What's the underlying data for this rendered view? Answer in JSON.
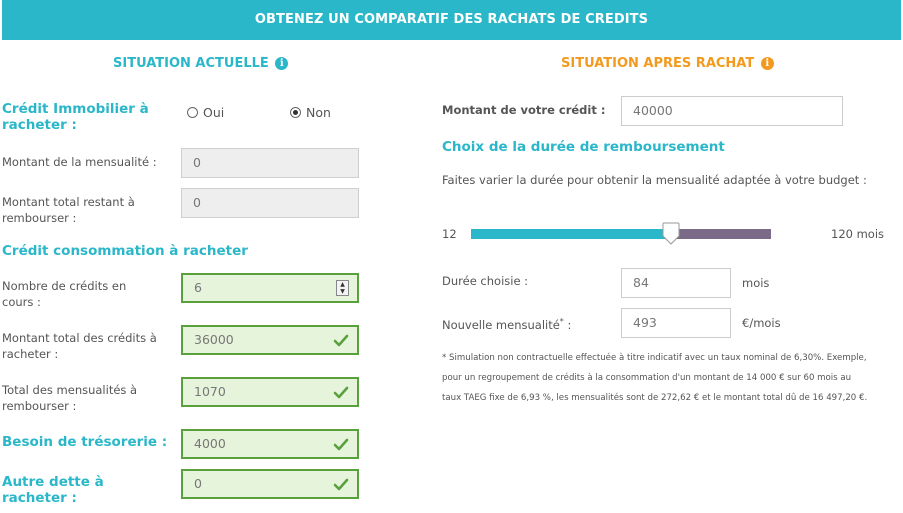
{
  "header": {
    "title": "OBTENEZ UN COMPARATIF DES RACHATS DE CREDITS"
  },
  "left": {
    "title": "SITUATION ACTUELLE",
    "info_icon": "i",
    "immo_label_1": "Crédit Immobilier à",
    "immo_label_2": "racheter :",
    "radio_oui": "Oui",
    "radio_non": "Non",
    "radio_selected": "Non",
    "mensualite_label": "Montant de la mensualité :",
    "mensualite_value": "0",
    "restant_label_1": "Montant total restant à",
    "restant_label_2": "rembourser :",
    "restant_value": "0",
    "conso_title": "Crédit consommation à racheter",
    "nb_credits_label_1": "Nombre de crédits en",
    "nb_credits_label_2": "cours :",
    "nb_credits_value": "6",
    "total_credits_label_1": "Montant total des crédits à",
    "total_credits_label_2": "racheter :",
    "total_credits_value": "36000",
    "total_mens_label_1": "Total des mensualités à",
    "total_mens_label_2": "rembourser :",
    "total_mens_value": "1070",
    "tresorerie_label": "Besoin de trésorerie :",
    "tresorerie_value": "4000",
    "autre_label_1": "Autre dette à",
    "autre_label_2": "racheter :",
    "autre_value": "0"
  },
  "right": {
    "title": "SITUATION APRES RACHAT",
    "info_icon": "i",
    "montant_label": "Montant de votre crédit :",
    "montant_value": "40000",
    "duree_title": "Choix de la durée de remboursement",
    "duree_help": "Faites varier la durée pour obtenir la mensualité adaptée à votre budget :",
    "slider_min": "12",
    "slider_max": "120 mois",
    "slider_value": 84,
    "slider_range": [
      12,
      120
    ],
    "duree_label": "Durée choisie :",
    "duree_value": "84",
    "duree_unit": "mois",
    "mensualite_label": "Nouvelle mensualité",
    "mensualite_star": "*",
    "mensualite_colon": " :",
    "mensualite_value": "493",
    "mensualite_unit": "€/mois",
    "note_1": "* Simulation non contractuelle effectuée à titre indicatif avec un taux nominal de 6,30%. Exemple,",
    "note_2": "pour un regroupement de crédits à la consommation d'un montant de 14 000 € sur 60 mois au",
    "note_3": "taux TAEG fixe de 6,93 %, les mensualités sont de 272,62 € et le montant total dû de 16 497,20 €."
  },
  "colors": {
    "teal": "#2ab7c9",
    "orange": "#f39a1e",
    "slider_rest": "#7a6a88",
    "valid_green": "#5aa13d"
  },
  "icons": {
    "valid": "check-icon",
    "info": "info-icon",
    "spinner": "spinner-arrows-icon"
  }
}
